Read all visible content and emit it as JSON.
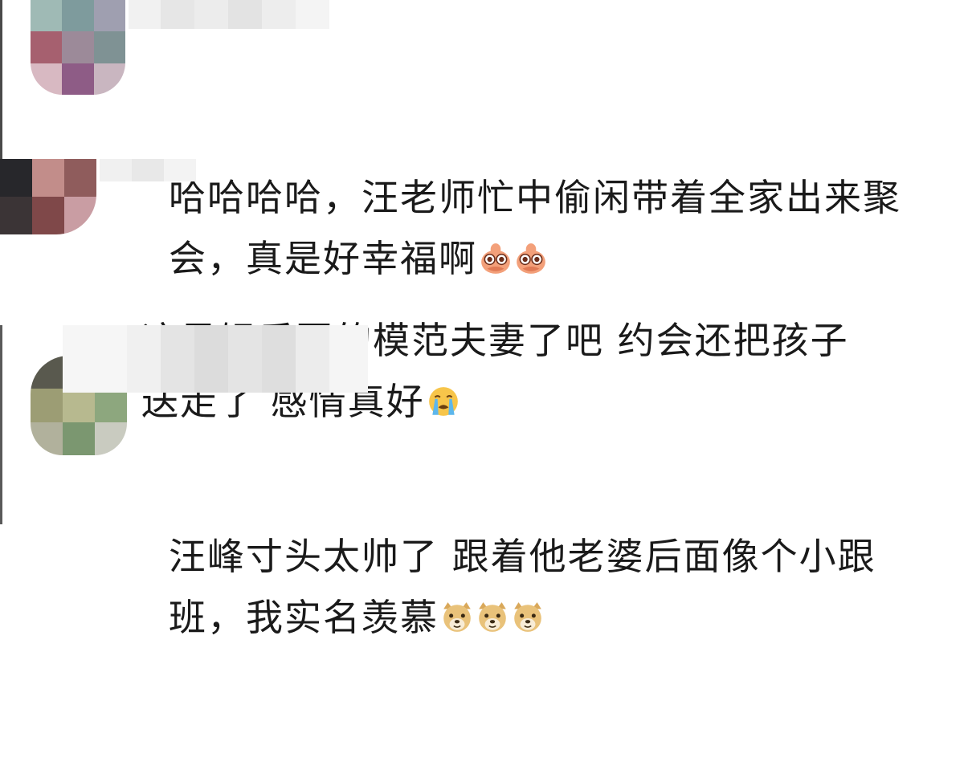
{
  "comments": [
    {
      "lines": [
        "哈哈哈哈，汪老师忙中偷闲带着全家出来聚",
        "会，真是好幸福啊"
      ],
      "emoji": [
        "peek-emoji",
        "peek-emoji"
      ]
    },
    {
      "lines": [
        "这是娱乐圈的模范夫妻了吧 约会还把孩子",
        "送走了 感情真好"
      ],
      "emoji": [
        "crying-emoji"
      ]
    },
    {
      "lines": [
        "汪峰寸头太帅了 跟着他老婆后面像个小跟",
        "班，我实名羡慕"
      ],
      "emoji": [
        "doge-emoji",
        "doge-emoji",
        "doge-emoji"
      ]
    }
  ],
  "colors": {
    "text": "#1a1a1a",
    "background": "#ffffff",
    "peek_emoji": "#f3a07a",
    "crying_emoji": "#f7c54a",
    "tears": "#5db7ec",
    "doge": "#e9c27a"
  }
}
